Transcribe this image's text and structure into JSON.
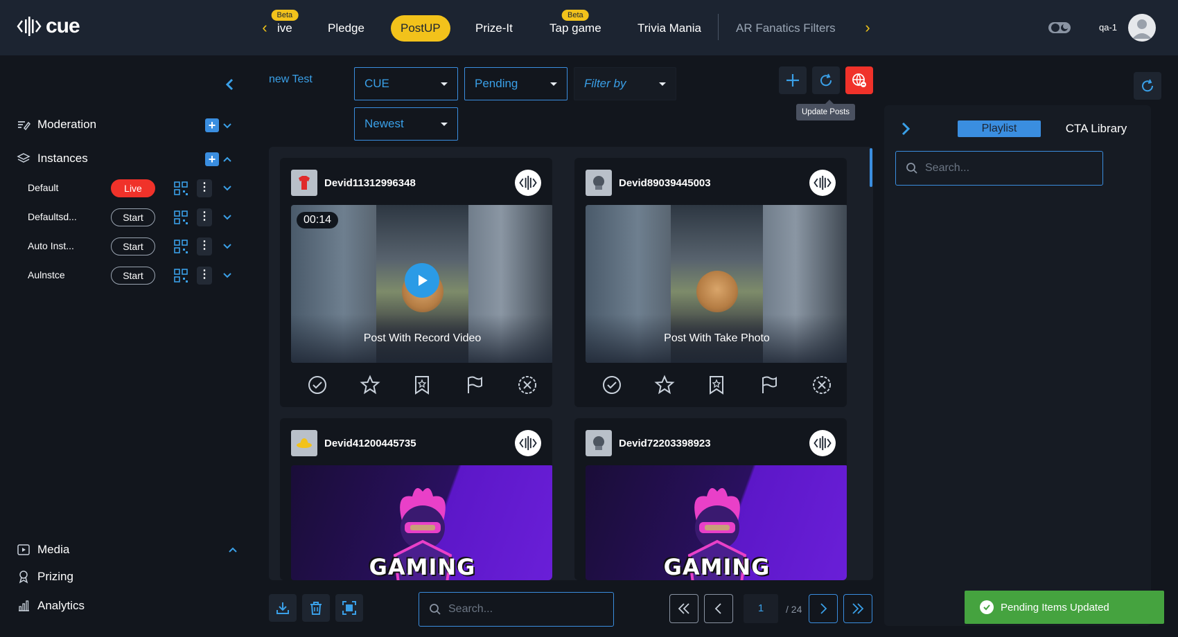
{
  "app": {
    "logo_text": "cue"
  },
  "nav": {
    "tabs": [
      {
        "label": "ive",
        "beta": "Beta"
      },
      {
        "label": "Pledge"
      },
      {
        "label": "PostUP",
        "active": true
      },
      {
        "label": "Prize-It"
      },
      {
        "label": "Tap game",
        "beta": "Beta"
      },
      {
        "label": "Trivia Mania"
      },
      {
        "label": "AR Fanatics Filters"
      }
    ],
    "beta_label": "Beta"
  },
  "user": {
    "name": "qa-1"
  },
  "sidebar": {
    "moderation": "Moderation",
    "instances": "Instances",
    "instance_list": [
      {
        "name": "Default",
        "status": "Live"
      },
      {
        "name": "Defaultsd...",
        "status": "Start"
      },
      {
        "name": "Auto Inst...",
        "status": "Start"
      },
      {
        "name": "Aulnstce",
        "status": "Start"
      }
    ],
    "media": "Media",
    "prizing": "Prizing",
    "analytics": "Analytics"
  },
  "main": {
    "crumb": "new Test",
    "filters": {
      "source": "CUE",
      "status": "Pending",
      "filter_by": "Filter by",
      "sort": "Newest"
    },
    "tooltip": "Update Posts",
    "posts": [
      {
        "user": "Devid11312996348",
        "caption": "Post With Record Video",
        "duration": "00:14",
        "type": "video"
      },
      {
        "user": "Devid89039445003",
        "caption": "Post With Take Photo",
        "type": "photo"
      },
      {
        "user": "Devid41200445735",
        "caption": "GAMING",
        "type": "gaming"
      },
      {
        "user": "Devid72203398923",
        "caption": "GAMING",
        "type": "gaming"
      }
    ],
    "search_placeholder": "Search...",
    "pagination": {
      "current": "1",
      "total": "/ 24"
    }
  },
  "right_panel": {
    "tab_playlist": "Playlist",
    "tab_cta": "CTA Library",
    "search_placeholder": "Search..."
  },
  "toast": {
    "message": "Pending Items Updated"
  },
  "colors": {
    "accent": "#3a8ee0",
    "brand_yellow": "#f2c21b",
    "live_red": "#f0322a",
    "success": "#45a33f"
  }
}
